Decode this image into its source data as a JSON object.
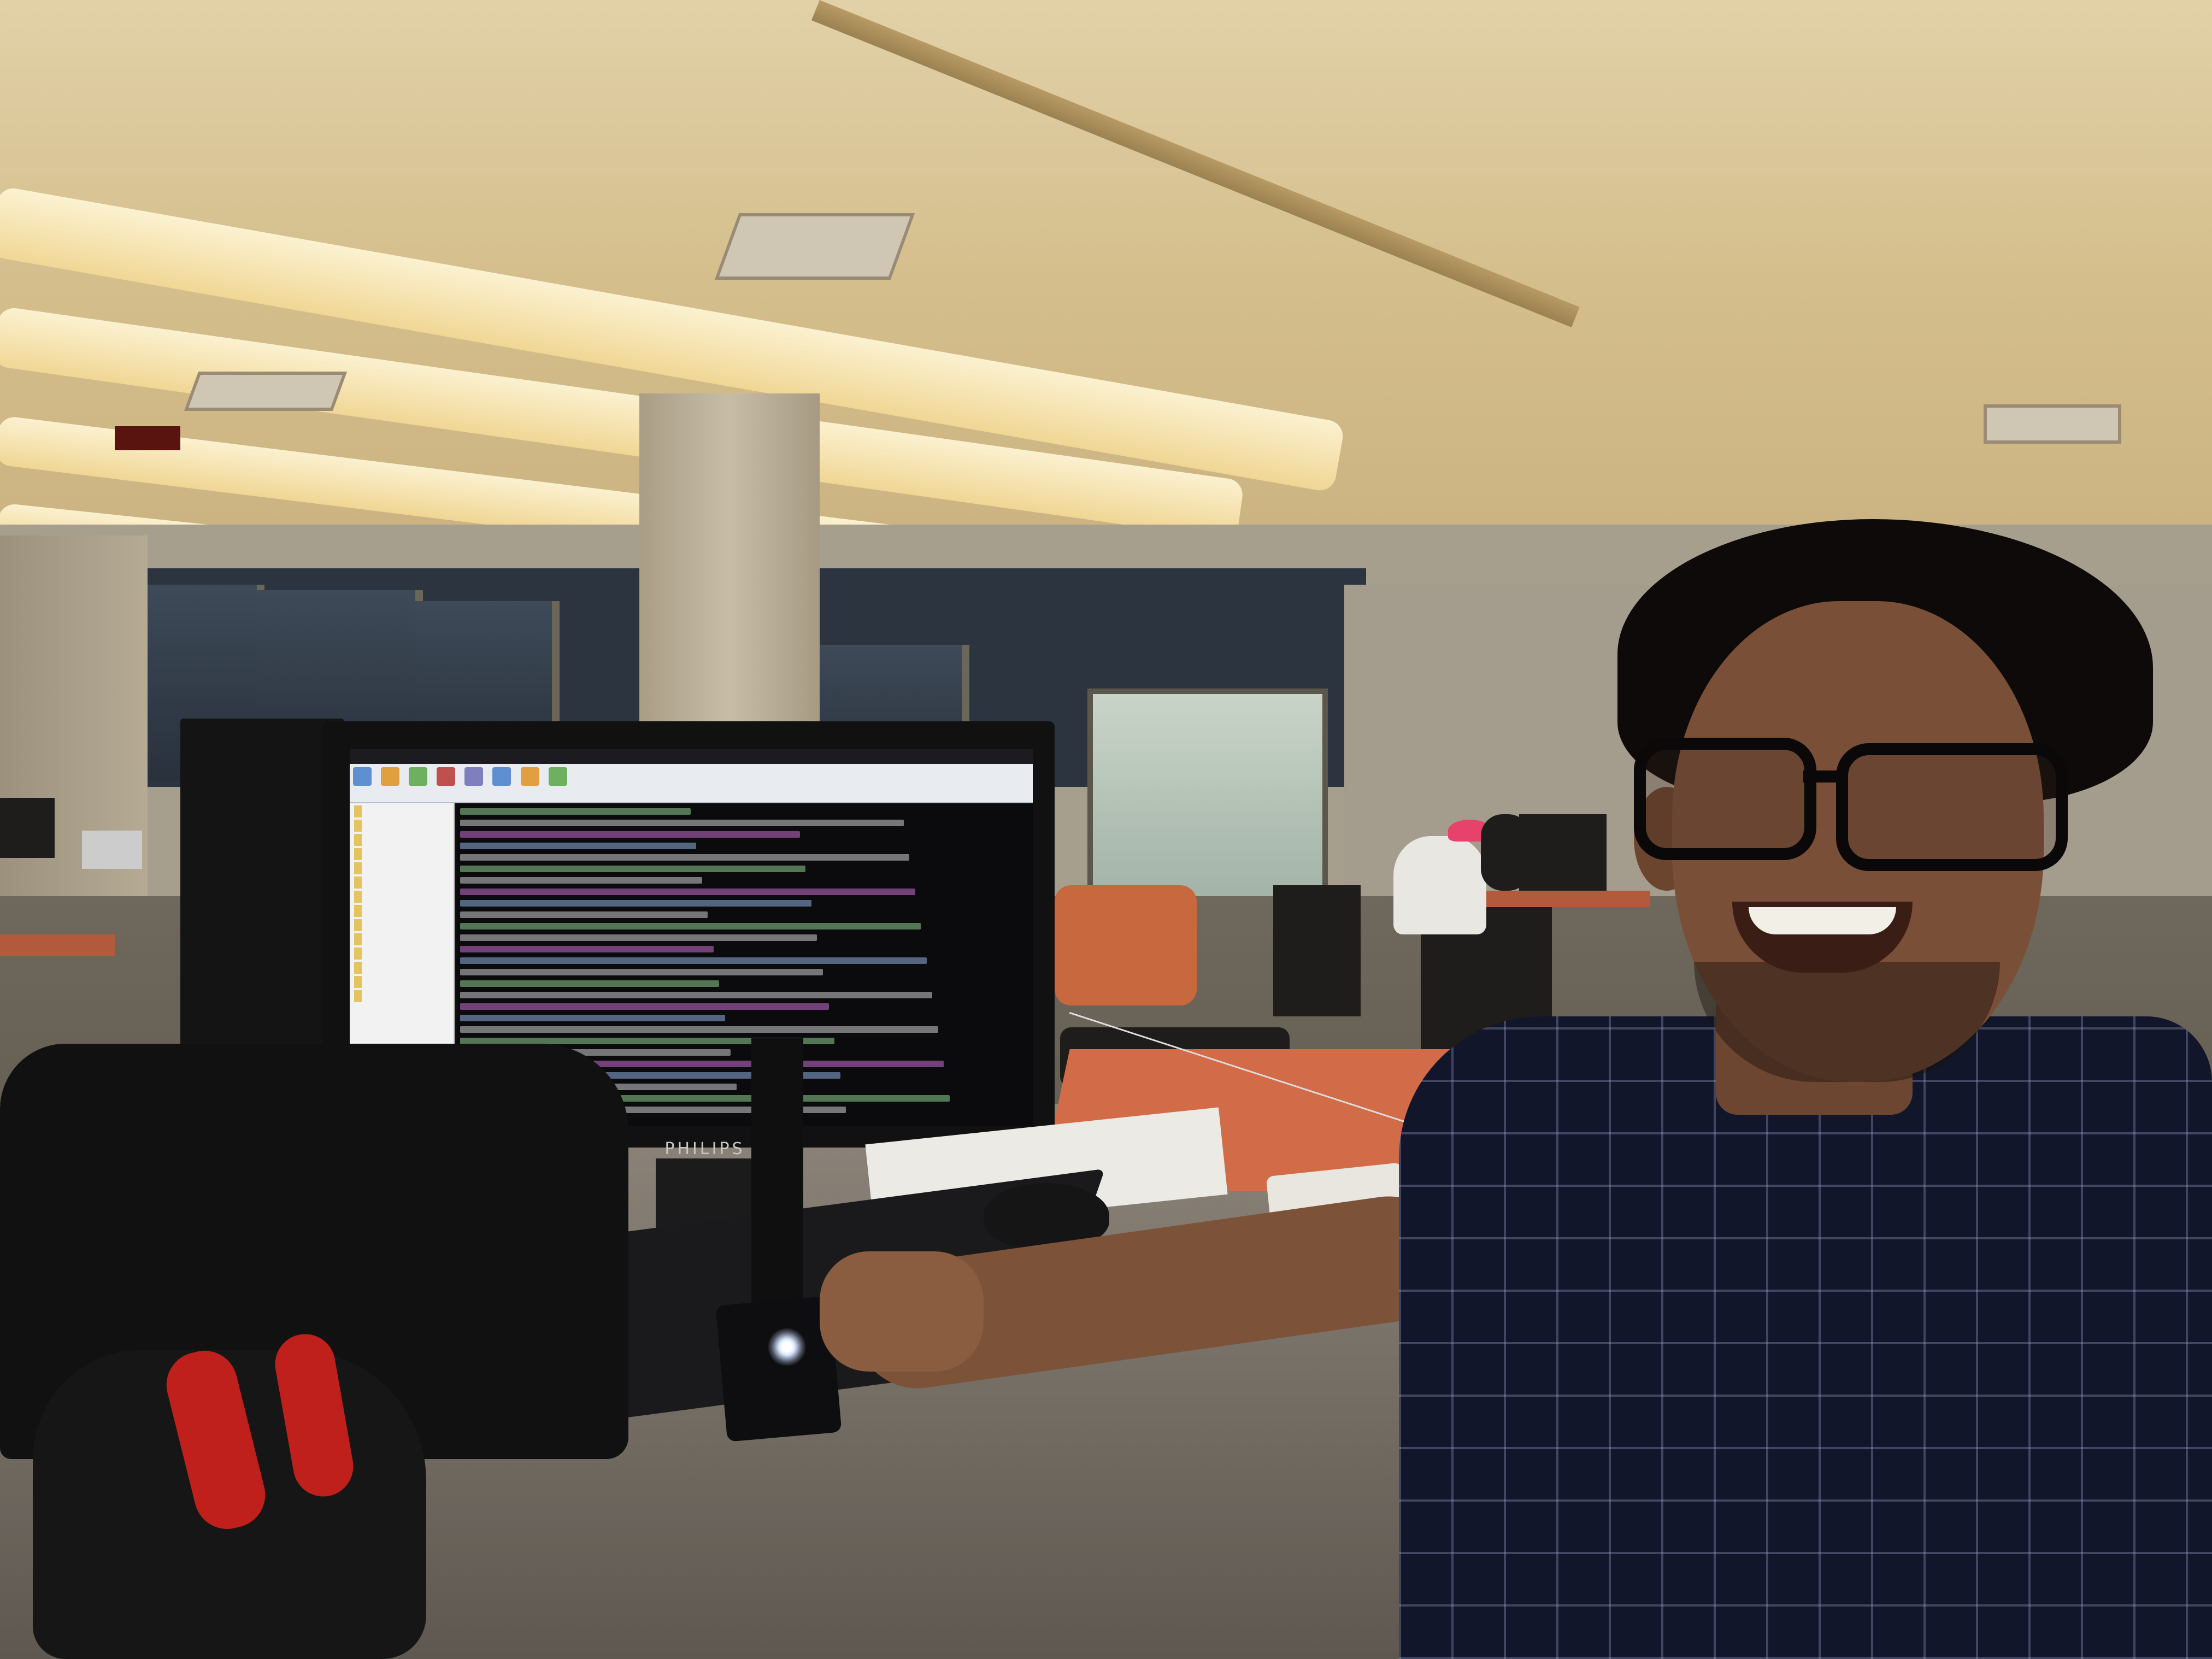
{
  "monitor": {
    "brand": "PHILIPS"
  },
  "colors": {
    "accent_orange": "#d26b48",
    "shirt_navy": "#12162a",
    "led_white": "#ffffff",
    "headphone_red": "#c0201c"
  }
}
